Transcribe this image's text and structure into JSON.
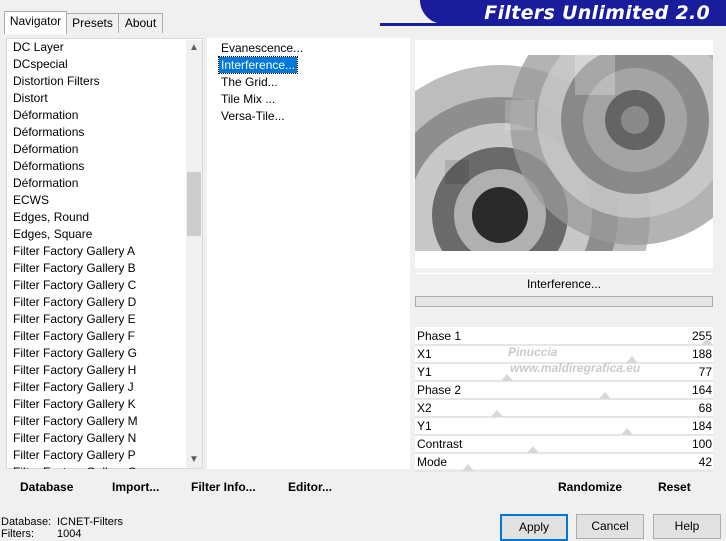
{
  "tabs": [
    {
      "label": "Navigator",
      "active": true
    },
    {
      "label": "Presets",
      "active": false
    },
    {
      "label": "About",
      "active": false
    }
  ],
  "banner": {
    "title": "Filters Unlimited 2.0",
    "color": "#1a1d9b"
  },
  "categories": [
    "DC Layer",
    "DCspecial",
    "Distortion Filters",
    "Distort",
    "Déformation",
    "Déformations",
    "Déformation",
    "Déformations",
    "Déformation",
    "ECWS",
    "Edges, Round",
    "Edges, Square",
    "Filter Factory Gallery A",
    "Filter Factory Gallery B",
    "Filter Factory Gallery C",
    "Filter Factory Gallery D",
    "Filter Factory Gallery E",
    "Filter Factory Gallery F",
    "Filter Factory Gallery G",
    "Filter Factory Gallery H",
    "Filter Factory Gallery J",
    "Filter Factory Gallery K",
    "Filter Factory Gallery M",
    "Filter Factory Gallery N",
    "Filter Factory Gallery P",
    "Filter Factory Gallery Q"
  ],
  "filters": [
    {
      "label": "Evanescence...",
      "selected": false
    },
    {
      "label": "Interference...",
      "selected": true
    },
    {
      "label": "The Grid...",
      "selected": false
    },
    {
      "label": "Tile Mix ...",
      "selected": false
    },
    {
      "label": "Versa-Tile...",
      "selected": false
    }
  ],
  "left_buttons": {
    "database": "Database",
    "import": "Import...",
    "filter_info": "Filter Info...",
    "editor": "Editor..."
  },
  "preview": {
    "filter_name": "Interference..."
  },
  "params": [
    {
      "label": "Phase 1",
      "value": "255",
      "level": 1.0
    },
    {
      "label": "X1",
      "value": "188",
      "level": 0.737
    },
    {
      "label": "Y1",
      "value": "77",
      "level": 0.302
    },
    {
      "label": "Phase 2",
      "value": "164",
      "level": 0.643
    },
    {
      "label": "X2",
      "value": "68",
      "level": 0.267
    },
    {
      "label": "Y1",
      "value": "184",
      "level": 0.722
    },
    {
      "label": "Contrast",
      "value": "100",
      "level": 0.392
    },
    {
      "label": "Mode",
      "value": "42",
      "level": 0.165
    }
  ],
  "right_buttons": {
    "randomize": "Randomize",
    "reset": "Reset"
  },
  "dialog_buttons": {
    "apply": "Apply",
    "cancel": "Cancel",
    "help": "Help"
  },
  "status": {
    "database_label": "Database:",
    "database_value": "ICNET-Filters",
    "filters_label": "Filters:",
    "filters_value": "1004"
  },
  "watermark": {
    "line1": "Pinuccia",
    "line2": "www.maldiregrafica.eu"
  }
}
